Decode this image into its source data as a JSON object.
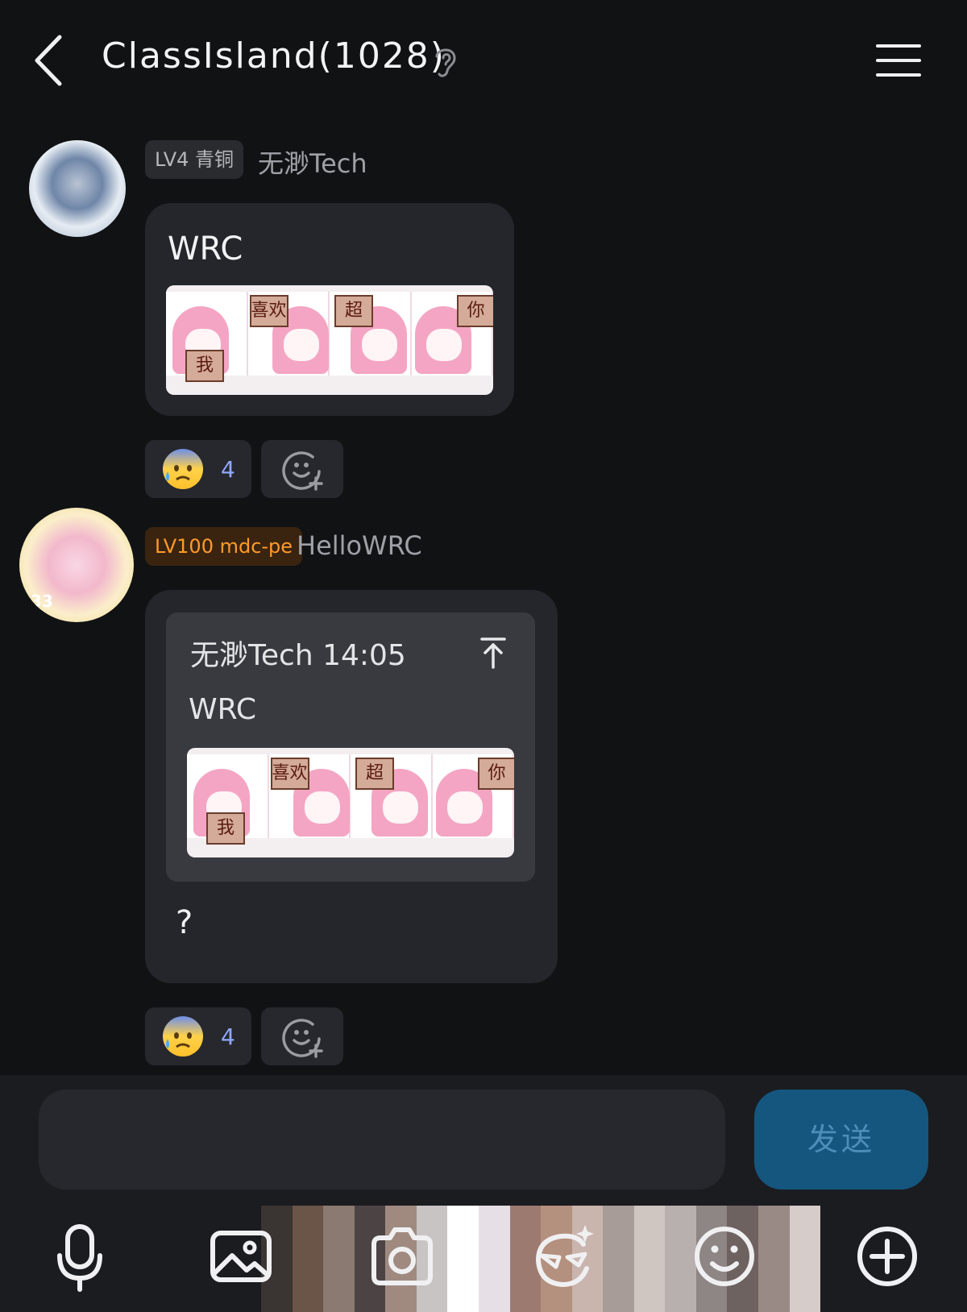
{
  "header": {
    "title": "ClassIsland(1028)"
  },
  "messages": [
    {
      "level": "LV4 青铜",
      "sender": "无渺Tech",
      "text": "WRC",
      "sticker_signs": [
        "我",
        "喜欢",
        "超",
        "你"
      ],
      "reaction_count": "4"
    },
    {
      "level": "LV100 mdc-pe",
      "sender": "HelloWRC",
      "avatar_badge": "33",
      "quote": {
        "header": "无渺Tech 14:05",
        "text": "WRC",
        "sticker_signs": [
          "我",
          "喜欢",
          "超",
          "你"
        ]
      },
      "text": "?",
      "reaction_count": "4"
    }
  ],
  "composer": {
    "input_value": "",
    "send_label": "发送"
  },
  "colors": {
    "background": "#111214",
    "bubble": "#24262b",
    "send_button": "#14567e",
    "level_tag_orange": "#ff9a2a",
    "reaction_count": "#8ea9ff"
  },
  "icons": {
    "back": "chevron-left-icon",
    "ear": "ear-icon",
    "menu": "hamburger-menu-icon",
    "reaction": "anxious-sweat-face-emoji",
    "add_reaction": "add-reaction-icon",
    "jump_to_quote": "arrow-up-to-line-icon",
    "toolbar": [
      "microphone-icon",
      "image-icon",
      "camera-icon",
      "sticker-ai-icon",
      "emoji-smile-icon",
      "plus-circle-icon"
    ]
  }
}
